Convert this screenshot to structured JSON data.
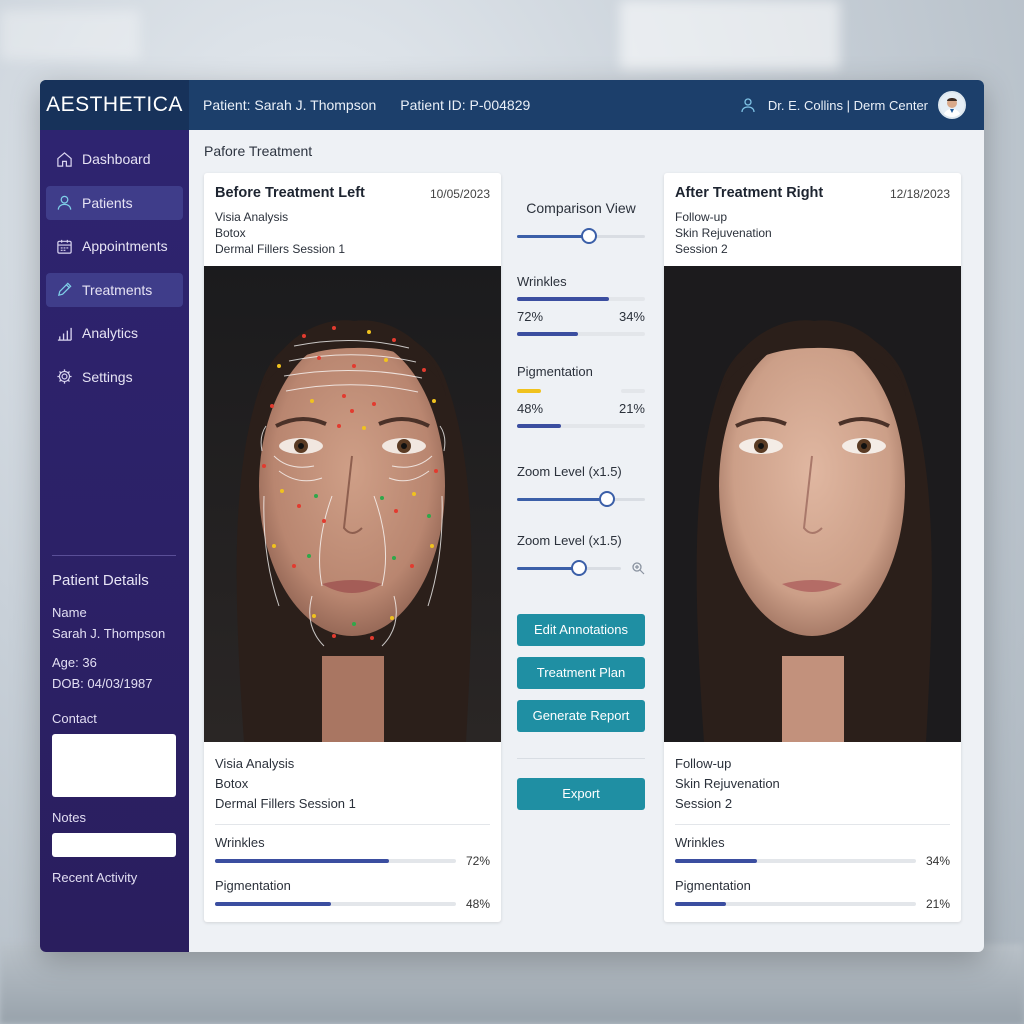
{
  "app": {
    "brand": "AESTHETICA",
    "patient_label": "Patient: Sarah J. Thompson",
    "patient_id": "Patient ID: P-004829",
    "user": "Dr. E. Collins | Derm Center"
  },
  "sidebar": {
    "items": [
      {
        "label": "Dashboard",
        "icon": "home-icon",
        "active": false
      },
      {
        "label": "Patients",
        "icon": "user-icon",
        "active": true
      },
      {
        "label": "Appointments",
        "icon": "calendar-icon",
        "active": false
      },
      {
        "label": "Treatments",
        "icon": "pencil-icon",
        "active": true
      },
      {
        "label": "Analytics",
        "icon": "bar-chart-icon",
        "active": false
      },
      {
        "label": "Settings",
        "icon": "gear-icon",
        "active": false
      }
    ],
    "details": {
      "title": "Patient Details",
      "name_label": "Name",
      "name": "Sarah J. Thompson",
      "age": "Age: 36",
      "dob": "DOB: 04/03/1987",
      "contact_label": "Contact",
      "notes_label": "Notes",
      "recent_label": "Recent Activity"
    }
  },
  "main": {
    "section_title": "Pafore Treatment",
    "before": {
      "title": "Before Treatment Left",
      "date": "10/05/2023",
      "lines": [
        "Visia Analysis",
        "Botox",
        "Dermal Fillers Session 1"
      ],
      "wrinkles_label": "Wrinkles",
      "wrinkles_value": "72%",
      "wrinkles_fraction": 0.72,
      "pigmentation_label": "Pigmentation",
      "pigmentation_value": "48%",
      "pigmentation_fraction": 0.48
    },
    "after": {
      "title": "After Treatment Right",
      "date": "12/18/2023",
      "lines": [
        "Follow-up",
        "Skin Rejuvenation",
        "Session 2"
      ],
      "wrinkles_label": "Wrinkles",
      "wrinkles_value": "34%",
      "wrinkles_fraction": 0.34,
      "pigmentation_label": "Pigmentation",
      "pigmentation_value": "21%",
      "pigmentation_fraction": 0.21
    },
    "center": {
      "comparison_label": "Comparison View",
      "comparison_level": 0.56,
      "wrinkles_label": "Wrinkles",
      "wrinkles_before": "72%",
      "wrinkles_after": "34%",
      "pigmentation_label": "Pigmentation",
      "pigmentation_before": "48%",
      "pigmentation_after": "21%",
      "zoom1_label": "Zoom Level (x1.5)",
      "zoom1_level": 0.7,
      "zoom2_label": "Zoom Level (x1.5)",
      "zoom2_level": 0.6,
      "buttons": {
        "edit": "Edit Annotations",
        "plan": "Treatment Plan",
        "report": "Generate Report",
        "export": "Export"
      }
    }
  },
  "colors": {
    "topbar": "#1c3f6b",
    "sidebar": "#2e2470",
    "accent_button": "#1f8fa3",
    "bar_fill": "#3b4ea0"
  }
}
